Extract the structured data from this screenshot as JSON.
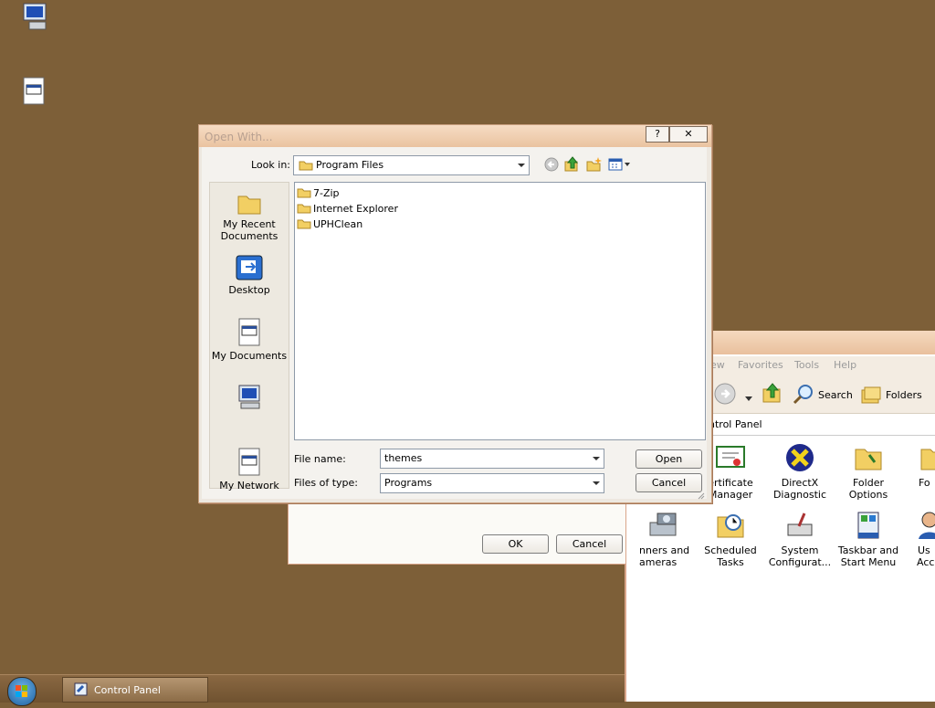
{
  "dialog": {
    "title": "Open With...",
    "help_label": "?",
    "close_label": "✕",
    "look_in_label": "Look in:",
    "look_in_value": "Program Files",
    "files": [
      "7-Zip",
      "Internet Explorer",
      "UPHClean"
    ],
    "places": {
      "recent": "My Recent\nDocuments",
      "desktop": "Desktop",
      "documents": "My Documents",
      "network": "My Network"
    },
    "file_name_label": "File name:",
    "file_name_value": "themes",
    "file_type_label": "Files of type:",
    "file_type_value": "Programs",
    "open_button": "Open",
    "cancel_button": "Cancel"
  },
  "behind_dialog": {
    "ok_button": "OK",
    "cancel_button": "Cancel"
  },
  "control_panel": {
    "menu": [
      "ew",
      "Favorites",
      "Tools",
      "Help"
    ],
    "toolbar": {
      "search": "Search",
      "folders": "Folders"
    },
    "address": "ntrol Panel",
    "items": [
      {
        "line1": "ertificate",
        "line2": "Manager"
      },
      {
        "line1": "DirectX",
        "line2": "Diagnostic"
      },
      {
        "line1": "Folder",
        "line2": "Options"
      },
      {
        "line1": "Fo",
        "line2": ""
      },
      {
        "line1": "nners and",
        "line2": "ameras"
      },
      {
        "line1": "Scheduled",
        "line2": "Tasks"
      },
      {
        "line1": "System",
        "line2": "Configurat..."
      },
      {
        "line1": "Taskbar and",
        "line2": "Start Menu"
      },
      {
        "line1": "Us",
        "line2": "Acco"
      }
    ]
  },
  "taskbar": {
    "task_label": "Control Panel"
  },
  "colors": {
    "desktop": "#7d5f38",
    "title_gradient_top": "#f6dcc4",
    "title_gradient_bottom": "#eac3a0",
    "folder": "#f2cf63"
  }
}
